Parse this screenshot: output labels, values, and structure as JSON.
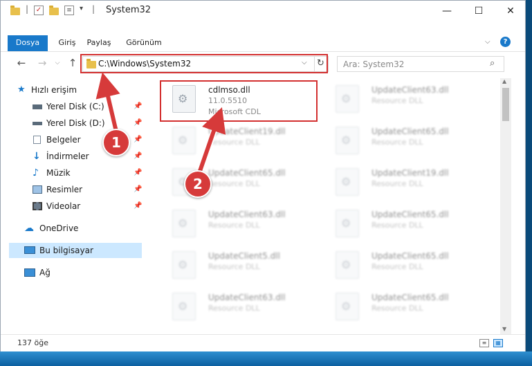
{
  "window": {
    "title": "System32",
    "minimize": "—",
    "maximize": "☐",
    "close": "✕"
  },
  "ribbon": {
    "tabs": [
      "Dosya",
      "Giriş",
      "Paylaş",
      "Görünüm"
    ],
    "help": "?"
  },
  "address": {
    "path": "C:\\Windows\\System32",
    "search_placeholder": "Ara: System32"
  },
  "sidebar": {
    "quick_access": "Hızlı erişim",
    "items": [
      {
        "label": "Yerel Disk (C:)",
        "icon": "drive-icon"
      },
      {
        "label": "Yerel Disk (D:)",
        "icon": "drive-icon"
      },
      {
        "label": "Belgeler",
        "icon": "documents-icon"
      },
      {
        "label": "İndirmeler",
        "icon": "downloads-icon"
      },
      {
        "label": "Müzik",
        "icon": "music-icon"
      },
      {
        "label": "Resimler",
        "icon": "pictures-icon"
      },
      {
        "label": "Videolar",
        "icon": "videos-icon"
      }
    ],
    "onedrive": "OneDrive",
    "this_pc": "Bu bilgisayar",
    "network": "Ağ"
  },
  "files": [
    {
      "name": "cdlmso.dll",
      "line2": "11.0.5510",
      "line3": "Microsoft CDL",
      "highlighted": true
    },
    {
      "name": "UpdateClient63.dll",
      "line2": "Resource DLL"
    },
    {
      "name": "UpdateClient19.dll",
      "line2": "Resource DLL"
    },
    {
      "name": "UpdateClient65.dll",
      "line2": "Resource DLL"
    },
    {
      "name": "UpdateClient65.dll",
      "line2": "Resource DLL"
    },
    {
      "name": "UpdateClient19.dll",
      "line2": "Resource DLL"
    },
    {
      "name": "UpdateClient63.dll",
      "line2": "Resource DLL"
    },
    {
      "name": "UpdateClient65.dll",
      "line2": "Resource DLL"
    },
    {
      "name": "UpdateClient5.dll",
      "line2": "Resource DLL"
    },
    {
      "name": "UpdateClient65.dll",
      "line2": "Resource DLL"
    },
    {
      "name": "UpdateClient63.dll",
      "line2": "Resource DLL"
    },
    {
      "name": "UpdateClient65.dll",
      "line2": "Resource DLL"
    }
  ],
  "status": {
    "count": "137 öğe"
  },
  "annotations": {
    "step1": "1",
    "step2": "2",
    "color": "#d32f2f"
  }
}
